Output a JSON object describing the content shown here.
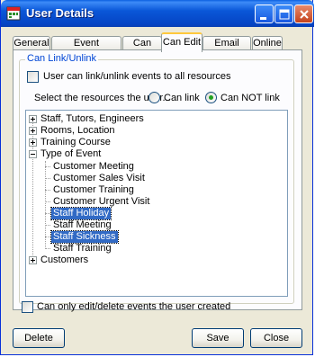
{
  "window": {
    "title": "User Details"
  },
  "tabs": [
    {
      "label": "General"
    },
    {
      "label": "Event Permission"
    },
    {
      "label": "Can See"
    },
    {
      "label": "Can Edit"
    },
    {
      "label": "Email Alerts"
    },
    {
      "label": "Online"
    }
  ],
  "active_tab": "Can Edit",
  "group": {
    "legend": "Can Link/Unlink",
    "all_resources_label": "User can link/unlink events to all resources",
    "select_label": "Select the resources the user...",
    "radio_can_link": "Can link",
    "radio_can_not_link": "Can NOT link",
    "selected_radio": "Can NOT link"
  },
  "tree": {
    "nodes": [
      {
        "label": "Staff, Tutors, Engineers",
        "level": 0,
        "expander": "plus",
        "selected": false
      },
      {
        "label": "Rooms, Location",
        "level": 0,
        "expander": "plus",
        "selected": false
      },
      {
        "label": "Training Course",
        "level": 0,
        "expander": "plus",
        "selected": false
      },
      {
        "label": "Type of Event",
        "level": 0,
        "expander": "minus",
        "selected": false
      },
      {
        "label": "Customer Meeting",
        "level": 1,
        "expander": "none",
        "selected": false
      },
      {
        "label": "Customer Sales Visit",
        "level": 1,
        "expander": "none",
        "selected": false
      },
      {
        "label": "Customer Training",
        "level": 1,
        "expander": "none",
        "selected": false
      },
      {
        "label": "Customer Urgent Visit",
        "level": 1,
        "expander": "none",
        "selected": false
      },
      {
        "label": "Staff Holiday",
        "level": 1,
        "expander": "none",
        "selected": true
      },
      {
        "label": "Staff Meeting",
        "level": 1,
        "expander": "none",
        "selected": false
      },
      {
        "label": "Staff Sickness",
        "level": 1,
        "expander": "none",
        "selected": true
      },
      {
        "label": "Staff Training",
        "level": 1,
        "expander": "none",
        "selected": false
      },
      {
        "label": "Customers",
        "level": 0,
        "expander": "plus",
        "selected": false
      }
    ]
  },
  "bottom_checkbox_label": "Can only edit/delete events the user created",
  "buttons": {
    "delete": "Delete",
    "save": "Save",
    "close": "Close"
  },
  "colors": {
    "title_bar": "#0a57d8",
    "selection": "#316ac5",
    "group_legend": "#0046d5",
    "active_tab_accent": "#ffc83c"
  }
}
